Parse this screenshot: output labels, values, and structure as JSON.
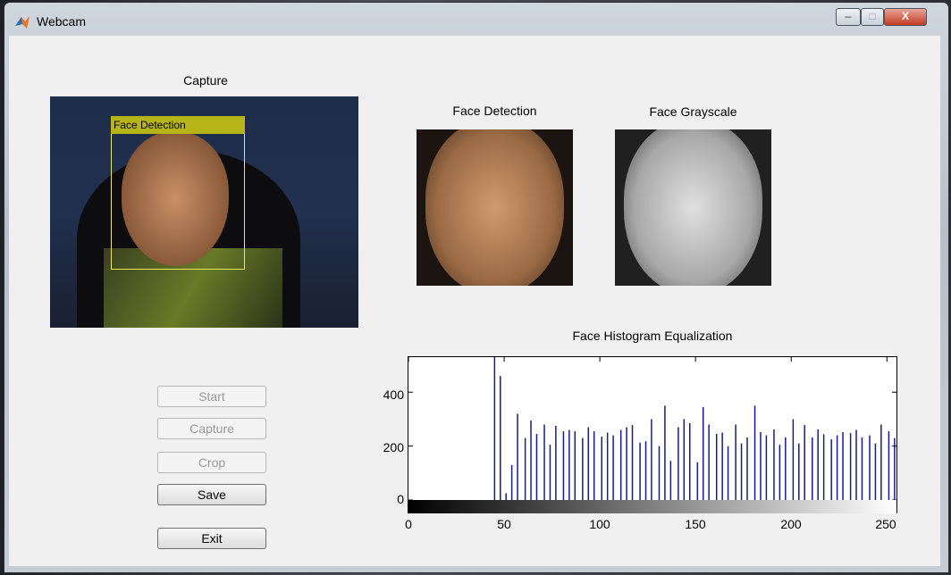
{
  "window": {
    "title": "Webcam",
    "controls": {
      "minimize": "–",
      "maximize": "□",
      "close": "X"
    }
  },
  "panels": {
    "capture_label": "Capture",
    "detection_overlay_label": "Face Detection",
    "face_detection_label": "Face Detection",
    "face_grayscale_label": "Face Grayscale",
    "histogram_label": "Face Histogram Equalization"
  },
  "buttons": {
    "start": "Start",
    "capture": "Capture",
    "crop": "Crop",
    "save": "Save",
    "exit": "Exit"
  },
  "chart_data": {
    "type": "bar",
    "xlim": [
      0,
      255
    ],
    "ylim": [
      0,
      530
    ],
    "xticks": [
      "0",
      "50",
      "100",
      "150",
      "200",
      "250"
    ],
    "yticks": [
      "0",
      "200",
      "400"
    ],
    "x": [
      45,
      48,
      51,
      54,
      57,
      61,
      64,
      67,
      71,
      74,
      77,
      81,
      84,
      87,
      91,
      94,
      97,
      101,
      104,
      107,
      111,
      114,
      117,
      121,
      124,
      127,
      131,
      134,
      137,
      141,
      144,
      147,
      151,
      154,
      157,
      161,
      164,
      167,
      171,
      174,
      177,
      181,
      184,
      187,
      191,
      194,
      197,
      201,
      204,
      207,
      211,
      214,
      217,
      221,
      224,
      227,
      231,
      234,
      237,
      241,
      244,
      247,
      251,
      254
    ],
    "values": [
      530,
      460,
      25,
      130,
      320,
      230,
      295,
      245,
      280,
      205,
      275,
      255,
      260,
      255,
      230,
      270,
      255,
      235,
      250,
      240,
      260,
      270,
      278,
      213,
      218,
      300,
      200,
      350,
      145,
      270,
      300,
      285,
      140,
      345,
      280,
      245,
      250,
      200,
      280,
      210,
      232,
      350,
      252,
      240,
      262,
      205,
      232,
      300,
      210,
      278,
      232,
      262,
      244,
      225,
      240,
      252,
      248,
      260,
      232,
      240,
      210,
      280,
      255,
      230
    ]
  }
}
